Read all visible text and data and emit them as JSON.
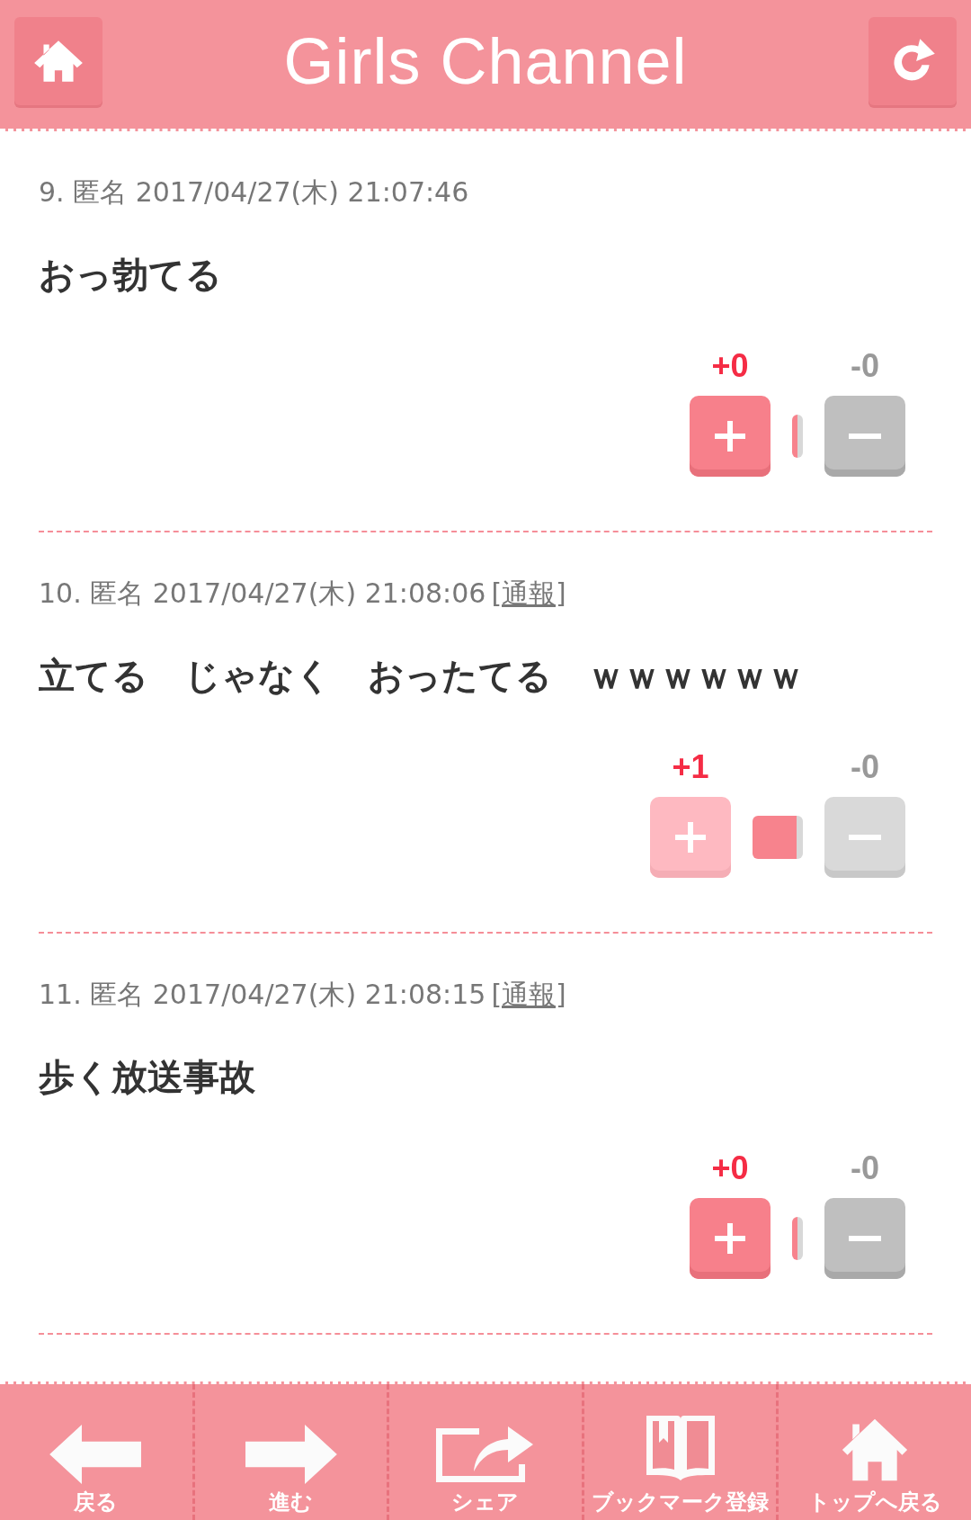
{
  "header": {
    "title": "Girls Channel"
  },
  "comments": [
    {
      "meta": "9. 匿名 2017/04/27(木) 21:07:46",
      "body": "おっ勃てる",
      "plus": "+0",
      "minus": "-0",
      "voted": false
    },
    {
      "meta": "10. 匿名 2017/04/27(木) 21:08:06",
      "report": "[通報]",
      "body": "立てる　じゃなく　おったてる　ｗｗｗｗｗｗ",
      "plus": "+1",
      "minus": "-0",
      "voted": true
    },
    {
      "meta": "11. 匿名 2017/04/27(木) 21:08:15",
      "report": "[通報]",
      "body": "歩く放送事故",
      "plus": "+0",
      "minus": "-0",
      "voted": false
    }
  ],
  "toolbar": [
    {
      "kind": "back",
      "label": "戻る"
    },
    {
      "kind": "forward",
      "label": "進む"
    },
    {
      "kind": "share",
      "label": "シェア"
    },
    {
      "kind": "bookmark",
      "label": "ブックマーク登録"
    },
    {
      "kind": "home",
      "label": "トップへ戻る"
    }
  ]
}
